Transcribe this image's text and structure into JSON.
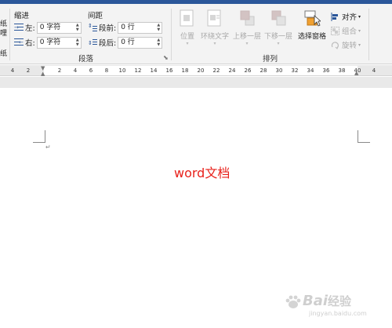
{
  "ribbon": {
    "left_fragments": [
      "纸",
      "哩",
      "纸"
    ],
    "indent": {
      "heading": "缩进",
      "left_label": "左:",
      "left_value": "0 字符",
      "right_label": "右:",
      "right_value": "0 字符"
    },
    "spacing": {
      "heading": "间距",
      "before_label": "段前:",
      "before_value": "0 行",
      "after_label": "段后:",
      "after_value": "0 行"
    },
    "paragraph_group_label": "段落",
    "arrange": {
      "group_label": "排列",
      "position": "位置",
      "wrap_text": "环绕文字",
      "bring_forward": "上移一层",
      "send_backward": "下移一层",
      "selection_pane": "选择窗格",
      "align": "对齐",
      "group": "组合",
      "rotate": "旋转"
    }
  },
  "ruler": {
    "ticks": [
      "4",
      "2",
      "2",
      "4",
      "6",
      "8",
      "10",
      "12",
      "14",
      "16",
      "18",
      "20",
      "22",
      "24",
      "26",
      "28",
      "30",
      "32",
      "34",
      "36",
      "38",
      "40",
      "4"
    ]
  },
  "document": {
    "text": "word文档",
    "text_color": "#e8201a"
  },
  "watermark": {
    "brand": "Bai",
    "brand_suffix": "经验",
    "url": "jingyan.baidu.com"
  },
  "colors": {
    "accent": "#2b579a"
  }
}
